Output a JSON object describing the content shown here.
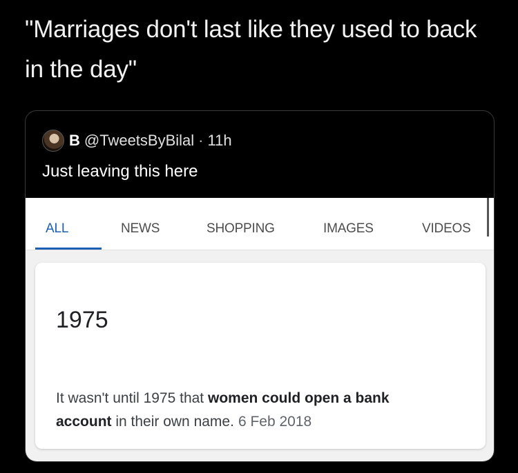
{
  "headline": "\"Marriages don't last like they used to back in the day\"",
  "quote": {
    "author": "B",
    "handle": "@TweetsByBilal",
    "separator": "·",
    "time": "11h",
    "text": "Just leaving this here"
  },
  "search": {
    "tabs": [
      "ALL",
      "NEWS",
      "SHOPPING",
      "IMAGES",
      "VIDEOS"
    ],
    "active_tab": "ALL",
    "accent_color": "#1a5fb4",
    "answer": "1975",
    "snippet_pre": "It wasn't until 1975 that ",
    "snippet_bold_1": "women could open a bank",
    "snippet_bold_2": "account",
    "snippet_post": " in their own name.",
    "date": "6 Feb 2018"
  }
}
